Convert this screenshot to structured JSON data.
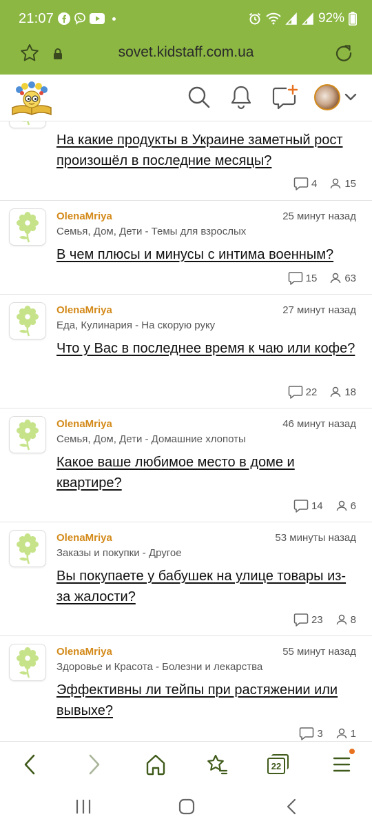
{
  "status_bar": {
    "time": "21:07",
    "battery": "92%",
    "left_icons": [
      "facebook-icon",
      "viber-icon",
      "youtube-icon"
    ],
    "right_icons": [
      "alarm-icon",
      "wifi-icon",
      "signal-icon",
      "battery-icon"
    ]
  },
  "browser": {
    "url": "sovet.kidstaff.com.ua"
  },
  "colors": {
    "brand_green": "#8cb743",
    "author_orange": "#d38a1a",
    "notification_dot": "#e8711f"
  },
  "posts": [
    {
      "title": "На какие продукты в Украине заметный рост произошёл в последние месяцы?",
      "comments": "4",
      "views": "15"
    },
    {
      "author": "OlenaMriya",
      "time": "25 минут назад",
      "category": "Семья, Дом, Дети - Темы для взрослых",
      "title": "В чем плюсы и минусы с интима военным?",
      "comments": "15",
      "views": "63"
    },
    {
      "author": "OlenaMriya",
      "time": "27 минут назад",
      "category": "Еда, Кулинария - На скорую руку",
      "title": "Что у Вас в последнее время к чаю или кофе?",
      "comments": "22",
      "views": "18"
    },
    {
      "author": "OlenaMriya",
      "time": "46 минут назад",
      "category": "Семья, Дом, Дети - Домашние хлопоты",
      "title": "Какое ваше любимое место в доме и квартире?",
      "comments": "14",
      "views": "6"
    },
    {
      "author": "OlenaMriya",
      "time": "53 минуты назад",
      "category": "Заказы и покупки - Другое",
      "title": "Вы покупаете у бабушек на улице товары из-за жалости?",
      "comments": "23",
      "views": "8"
    },
    {
      "author": "OlenaMriya",
      "time": "55 минут назад",
      "category": "Здоровье и Красота - Болезни и лекарства",
      "title": "Эффективны ли тейпы при растяжении или вывыхе?",
      "comments": "3",
      "views": "1"
    }
  ],
  "bottom_nav": {
    "tabs_count": "22"
  }
}
